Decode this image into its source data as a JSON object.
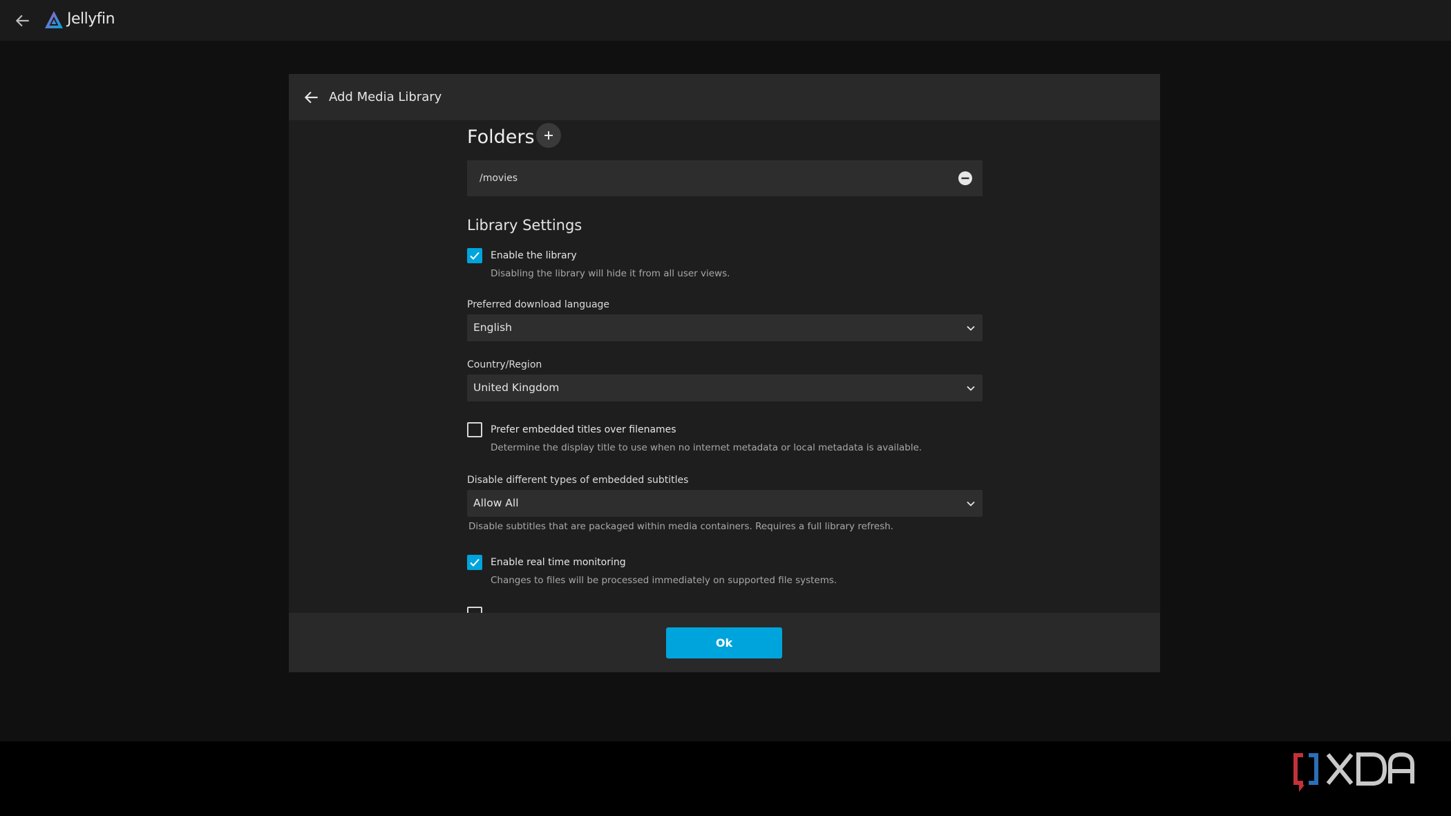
{
  "header": {
    "brand": "Jellyfin",
    "back_icon": "arrow-left-icon",
    "logo_icon": "jellyfin-logo-icon"
  },
  "dialog": {
    "title": "Add Media Library",
    "folders": {
      "title": "Folders",
      "items": [
        "/movies"
      ]
    },
    "library_settings": {
      "title": "Library Settings",
      "enable_library": {
        "label": "Enable the library",
        "checked": true,
        "help": "Disabling the library will hide it from all user views."
      },
      "preferred_language": {
        "label": "Preferred download language",
        "value": "English"
      },
      "country_region": {
        "label": "Country/Region",
        "value": "United Kingdom"
      },
      "prefer_embedded_titles": {
        "label": "Prefer embedded titles over filenames",
        "checked": false,
        "help": "Determine the display title to use when no internet metadata or local metadata is available."
      },
      "embedded_subtitles": {
        "label": "Disable different types of embedded subtitles",
        "value": "Allow All",
        "help": "Disable subtitles that are packaged within media containers. Requires a full library refresh."
      },
      "realtime_monitoring": {
        "label": "Enable real time monitoring",
        "checked": true,
        "help": "Changes to files will be processed immediately on supported file systems."
      }
    },
    "ok_label": "Ok"
  },
  "colors": {
    "accent": "#00a4dc",
    "background": "#101010",
    "dialog": "#1e1e1e"
  }
}
